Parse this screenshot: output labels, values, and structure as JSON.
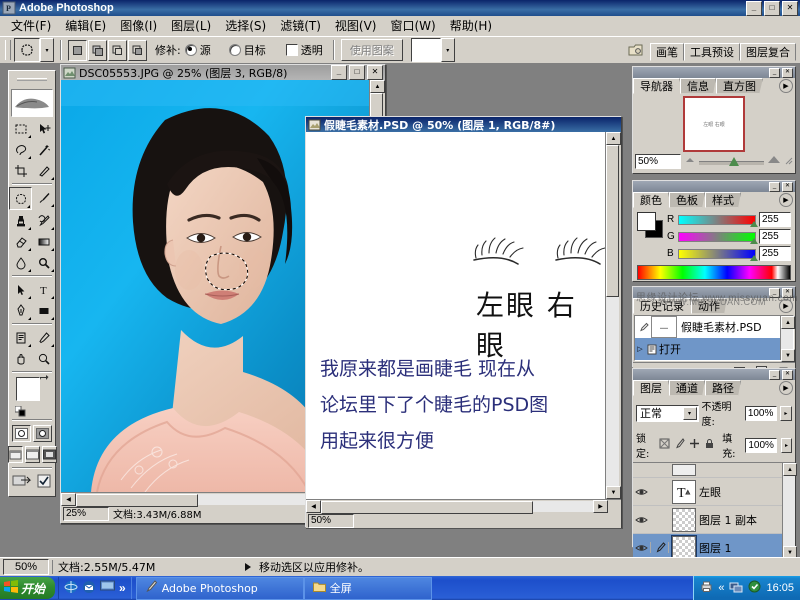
{
  "app": {
    "title": "Adobe Photoshop",
    "window_buttons": [
      "_",
      "□",
      "✕"
    ]
  },
  "menubar": {
    "items": [
      {
        "label": "文件(F)"
      },
      {
        "label": "编辑(E)"
      },
      {
        "label": "图像(I)"
      },
      {
        "label": "图层(L)"
      },
      {
        "label": "选择(S)"
      },
      {
        "label": "滤镜(T)"
      },
      {
        "label": "视图(V)"
      },
      {
        "label": "窗口(W)"
      },
      {
        "label": "帮助(H)"
      }
    ]
  },
  "options_bar": {
    "tool_icon": "patch-tool-icon",
    "selection_modes": [
      "new-selection",
      "add-to-selection",
      "subtract-from-selection",
      "intersect-selection"
    ],
    "patch_label": "修补:",
    "radio_source": "源",
    "radio_destination": "目标",
    "checkbox_transparent": "透明",
    "use_pattern_button": "使用图案",
    "palette_well": [
      "画笔",
      "工具预设",
      "图层复合"
    ]
  },
  "toolbox": {
    "tools": [
      "marquee-tool",
      "move-tool",
      "lasso-tool",
      "magic-wand-tool",
      "crop-tool",
      "slice-tool",
      "patch-tool",
      "brush-tool",
      "clone-stamp-tool",
      "history-brush-tool",
      "eraser-tool",
      "gradient-tool",
      "blur-tool",
      "dodge-tool",
      "path-selection-tool",
      "type-tool",
      "pen-tool",
      "shape-tool",
      "notes-tool",
      "eyedropper-tool",
      "hand-tool",
      "zoom-tool"
    ],
    "foreground_color": "#ffffff",
    "background_color": "#000000",
    "swap-colors-icon": "swap-colors-icon",
    "quickmask_modes": [
      "standard-mask-mode",
      "quick-mask-mode"
    ],
    "screen_modes": [
      "standard-screen-mode",
      "full-screen-menubar-mode",
      "full-screen-mode"
    ],
    "jump_to_imageready": "jump-to-imageready-icon"
  },
  "documents": [
    {
      "title": "DSC05553.JPG @ 25% (图层 3, RGB/8)",
      "zoom": "25%",
      "doc_size": "文档:3.43M/6.88M",
      "window_buttons": [
        "_",
        "□",
        "✕"
      ],
      "active": false
    },
    {
      "title": "假睫毛素材.PSD @ 50% (图层 1, RGB/8#)",
      "zoom": "50%",
      "active": true,
      "canvas": {
        "eyelash_labels": "左眼 右眼",
        "handwriting_lines": [
          "我原来都是画睫毛 现在从",
          "论坛里下了个睫毛的PSD图",
          "用起来很方便"
        ],
        "handwriting_color": "#2b2f7a"
      }
    }
  ],
  "palettes": {
    "navigator": {
      "tabs": [
        "导航器",
        "信息",
        "直方图"
      ],
      "selected_tab": "导航器",
      "zoom_value": "50%",
      "thumbnail_caption": "左眼 右眼"
    },
    "color": {
      "tabs": [
        "颜色",
        "色板",
        "样式"
      ],
      "selected_tab": "颜色",
      "channels": [
        {
          "label": "R",
          "value": "255"
        },
        {
          "label": "G",
          "value": "255"
        },
        {
          "label": "B",
          "value": "255"
        }
      ]
    },
    "history": {
      "tabs": [
        "历史记录",
        "动作"
      ],
      "selected_tab": "历史记录",
      "snapshot": "假睫毛素材.PSD",
      "states": [
        {
          "label": "打开",
          "selected": true
        }
      ]
    },
    "layers": {
      "tabs": [
        "图层",
        "通道",
        "路径"
      ],
      "selected_tab": "图层",
      "blend_mode": "正常",
      "opacity_label": "不透明度:",
      "opacity_value": "100%",
      "lock_label": "锁定:",
      "lock_icons": [
        "lock-transparency-icon",
        "lock-image-icon",
        "lock-position-icon",
        "lock-all-icon"
      ],
      "fill_label": "填充:",
      "fill_value": "100%",
      "rows": [
        {
          "name": "左眼",
          "type": "type-layer",
          "selected": false,
          "visible": true
        },
        {
          "name": "图层 1 副本",
          "type": "pixel-layer",
          "selected": false,
          "visible": true
        },
        {
          "name": "图层 1",
          "type": "pixel-layer",
          "selected": true,
          "visible": true
        }
      ],
      "footer_buttons": [
        "add-layer-style-button",
        "add-layer-mask-button",
        "new-group-button",
        "new-fill-layer-button",
        "new-layer-button",
        "delete-layer-button"
      ]
    }
  },
  "status_bar": {
    "zoom": "50%",
    "doc_size": "文档:2.55M/5.47M",
    "hint": "移动选区以应用修补。"
  },
  "taskbar": {
    "start": "开始",
    "quick_launch": [
      "internet-explorer-icon",
      "outlook-icon",
      "show-desktop-icon",
      "chevron-double-right-icon"
    ],
    "tasks": [
      {
        "label": "Adobe Photoshop",
        "icon": "photoshop-icon"
      },
      {
        "label": "全屏",
        "icon": "folder-icon"
      }
    ],
    "tray_icons": [
      "printer-icon",
      "chevron-left-icon",
      "network-icon",
      "shield-icon"
    ],
    "clock": "16:05"
  },
  "watermark": {
    "url": "WWW.MISSYUAN.COM",
    "text": "思缘设计论坛 www.missyuan.com"
  },
  "colors": {
    "desktop": "#808080",
    "chrome": "#d4d0c8",
    "titlebar_active": "#0a246a",
    "selection_blue": "#6f96c8"
  }
}
